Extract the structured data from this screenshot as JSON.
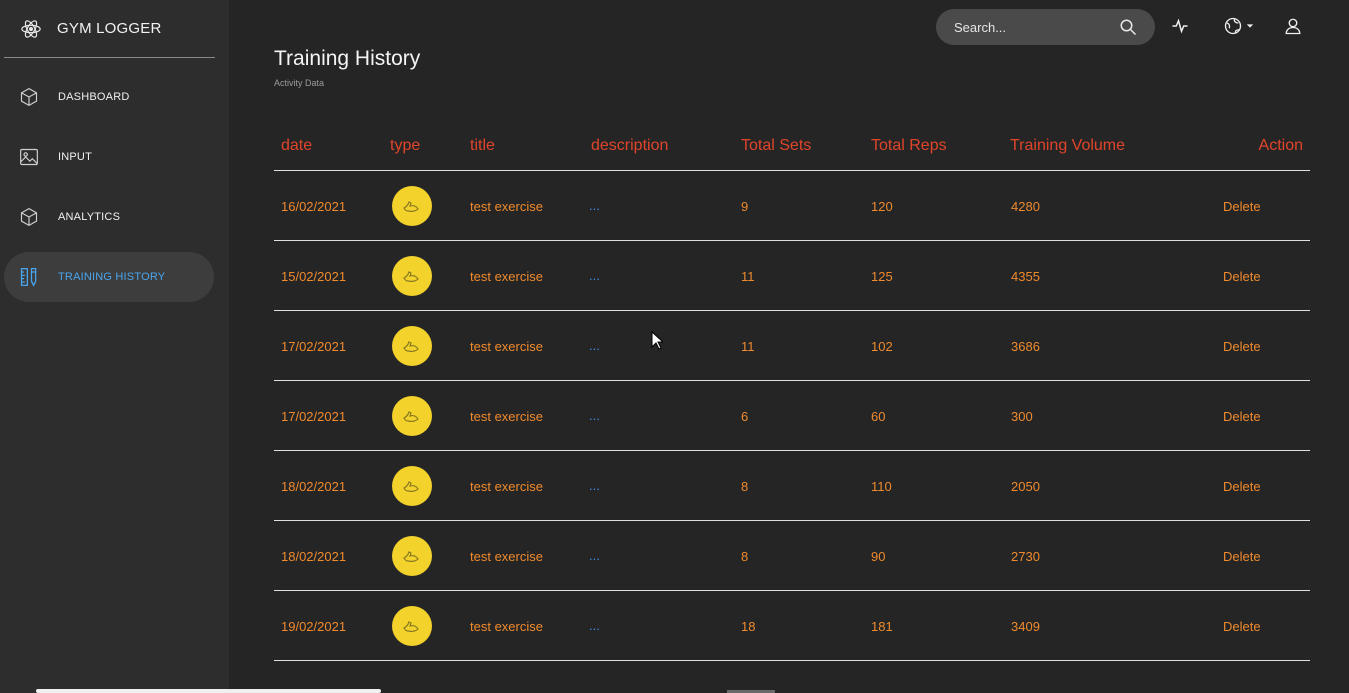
{
  "brand": {
    "name": "GYM LOGGER",
    "icon": "atom-icon"
  },
  "nav": [
    {
      "label": "DASHBOARD",
      "icon": "cube-icon",
      "active": false
    },
    {
      "label": "INPUT",
      "icon": "image-icon",
      "active": false
    },
    {
      "label": "ANALYTICS",
      "icon": "cube-icon",
      "active": false
    },
    {
      "label": "TRAINING HISTORY",
      "icon": "ruler-pencil-icon",
      "active": true
    }
  ],
  "search": {
    "placeholder": "Search..."
  },
  "page": {
    "title": "Training History",
    "subtitle": "Activity Data"
  },
  "table": {
    "headers": [
      "date",
      "type",
      "title",
      "description",
      "Total Sets",
      "Total Reps",
      "Training Volume",
      "Action"
    ],
    "rows": [
      {
        "date": "16/02/2021",
        "title": "test exercise",
        "description": "...",
        "sets": "9",
        "reps": "120",
        "volume": "4280",
        "action": "Delete"
      },
      {
        "date": "15/02/2021",
        "title": "test exercise",
        "description": "...",
        "sets": "11",
        "reps": "125",
        "volume": "4355",
        "action": "Delete"
      },
      {
        "date": "17/02/2021",
        "title": "test exercise",
        "description": "...",
        "sets": "11",
        "reps": "102",
        "volume": "3686",
        "action": "Delete"
      },
      {
        "date": "17/02/2021",
        "title": "test exercise",
        "description": "...",
        "sets": "6",
        "reps": "60",
        "volume": "300",
        "action": "Delete"
      },
      {
        "date": "18/02/2021",
        "title": "test exercise",
        "description": "...",
        "sets": "8",
        "reps": "110",
        "volume": "2050",
        "action": "Delete"
      },
      {
        "date": "18/02/2021",
        "title": "test exercise",
        "description": "...",
        "sets": "8",
        "reps": "90",
        "volume": "2730",
        "action": "Delete"
      },
      {
        "date": "19/02/2021",
        "title": "test exercise",
        "description": "...",
        "sets": "18",
        "reps": "181",
        "volume": "3409",
        "action": "Delete"
      }
    ]
  },
  "colors": {
    "background": "#252526",
    "sidebar": "#2d2d2d",
    "header_text": "#e0452a",
    "cell_text": "#f08a2c",
    "link": "#3d8fe8",
    "active_nav": "#4aa6f0",
    "badge": "#f2d22b"
  }
}
